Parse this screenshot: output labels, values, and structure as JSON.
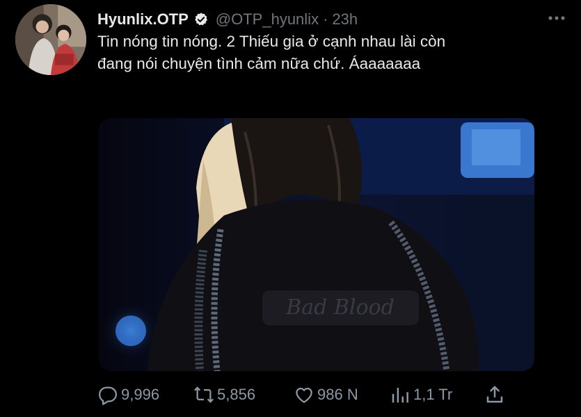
{
  "tweet": {
    "display_name": "Hyunlix.OTP",
    "handle": "@OTP_hyunlix",
    "separator": "·",
    "time": "23h",
    "text_line1": "Tin nóng tin nóng. 2 Thiếu gia ở cạnh nhau lài còn",
    "text_line2": "đang nói chuyện tình cảm nữa chứ. Áaaaaaaa",
    "media_text": "Bad Blood"
  },
  "actions": {
    "replies": "9,996",
    "retweets": "5,856",
    "likes": "986 N",
    "views": "1,1 Tr"
  },
  "icons": {
    "verified": "verified-badge-icon",
    "more": "more-dots-icon",
    "reply": "reply-icon",
    "retweet": "retweet-icon",
    "like": "heart-icon",
    "views": "views-icon",
    "share": "share-icon"
  },
  "colors": {
    "background": "#000000",
    "text": "#e7e9ea",
    "muted": "#71767b",
    "action": "#8b98a5"
  }
}
